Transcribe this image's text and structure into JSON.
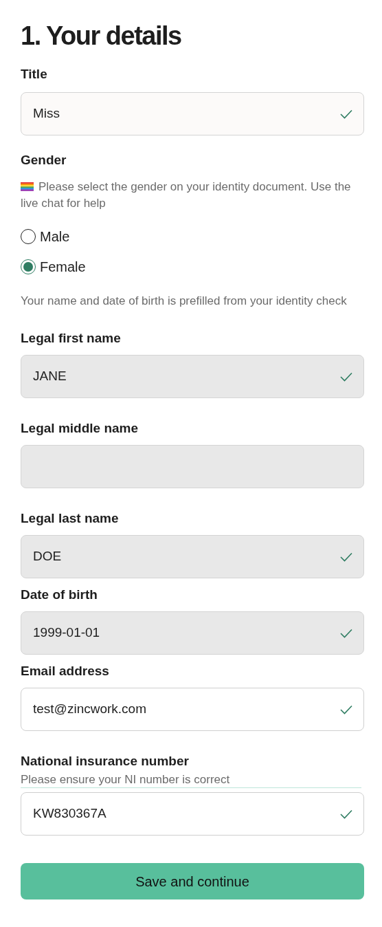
{
  "heading": "1. Your details",
  "title_field": {
    "label": "Title",
    "kind": "select",
    "value": "Miss",
    "valid": true
  },
  "gender": {
    "label": "Gender",
    "hint": "Please select the gender on your identity document. Use the live chat for help",
    "options": [
      {
        "label": "Male",
        "selected": false
      },
      {
        "label": "Female",
        "selected": true
      }
    ]
  },
  "prefill_note": "Your name and date of birth is prefilled from your identity check",
  "fields": [
    {
      "label": "Legal first name",
      "kind": "locked",
      "value": "JANE",
      "valid": true
    },
    {
      "label": "Legal middle name",
      "kind": "locked",
      "valid": false
    },
    {
      "label": "Legal last name",
      "kind": "locked",
      "value": "DOE",
      "valid": true
    },
    {
      "label": "Date of birth",
      "kind": "locked",
      "value": "1999-01-01",
      "valid": true
    },
    {
      "label": "Email address",
      "kind": "text",
      "value": "test@zincwork.com",
      "valid": true
    },
    {
      "label": "National insurance number",
      "hint": "Please ensure your NI number is correct",
      "kind": "text",
      "value": "KW830367A",
      "valid": true
    }
  ],
  "submit": "Save and continue"
}
